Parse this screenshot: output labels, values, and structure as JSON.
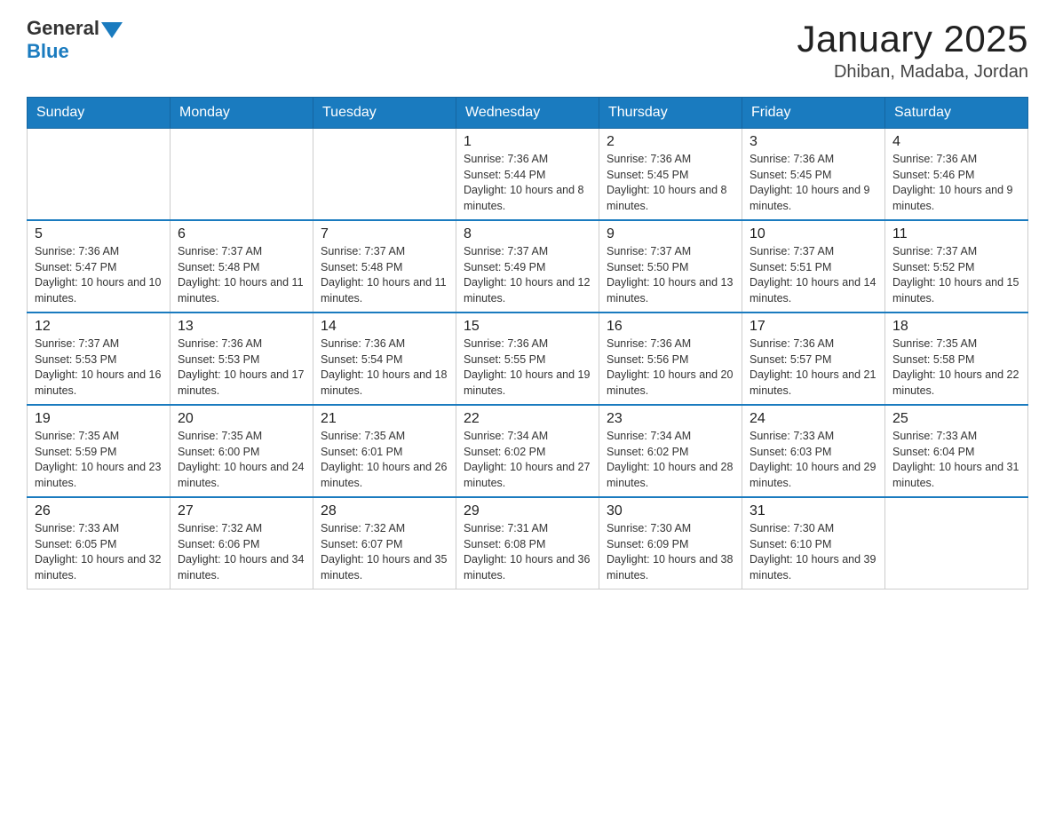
{
  "header": {
    "logo_text_main": "General",
    "logo_text_blue": "Blue",
    "title": "January 2025",
    "subtitle": "Dhiban, Madaba, Jordan"
  },
  "days_of_week": [
    "Sunday",
    "Monday",
    "Tuesday",
    "Wednesday",
    "Thursday",
    "Friday",
    "Saturday"
  ],
  "weeks": [
    [
      {
        "day": "",
        "info": ""
      },
      {
        "day": "",
        "info": ""
      },
      {
        "day": "",
        "info": ""
      },
      {
        "day": "1",
        "info": "Sunrise: 7:36 AM\nSunset: 5:44 PM\nDaylight: 10 hours and 8 minutes."
      },
      {
        "day": "2",
        "info": "Sunrise: 7:36 AM\nSunset: 5:45 PM\nDaylight: 10 hours and 8 minutes."
      },
      {
        "day": "3",
        "info": "Sunrise: 7:36 AM\nSunset: 5:45 PM\nDaylight: 10 hours and 9 minutes."
      },
      {
        "day": "4",
        "info": "Sunrise: 7:36 AM\nSunset: 5:46 PM\nDaylight: 10 hours and 9 minutes."
      }
    ],
    [
      {
        "day": "5",
        "info": "Sunrise: 7:36 AM\nSunset: 5:47 PM\nDaylight: 10 hours and 10 minutes."
      },
      {
        "day": "6",
        "info": "Sunrise: 7:37 AM\nSunset: 5:48 PM\nDaylight: 10 hours and 11 minutes."
      },
      {
        "day": "7",
        "info": "Sunrise: 7:37 AM\nSunset: 5:48 PM\nDaylight: 10 hours and 11 minutes."
      },
      {
        "day": "8",
        "info": "Sunrise: 7:37 AM\nSunset: 5:49 PM\nDaylight: 10 hours and 12 minutes."
      },
      {
        "day": "9",
        "info": "Sunrise: 7:37 AM\nSunset: 5:50 PM\nDaylight: 10 hours and 13 minutes."
      },
      {
        "day": "10",
        "info": "Sunrise: 7:37 AM\nSunset: 5:51 PM\nDaylight: 10 hours and 14 minutes."
      },
      {
        "day": "11",
        "info": "Sunrise: 7:37 AM\nSunset: 5:52 PM\nDaylight: 10 hours and 15 minutes."
      }
    ],
    [
      {
        "day": "12",
        "info": "Sunrise: 7:37 AM\nSunset: 5:53 PM\nDaylight: 10 hours and 16 minutes."
      },
      {
        "day": "13",
        "info": "Sunrise: 7:36 AM\nSunset: 5:53 PM\nDaylight: 10 hours and 17 minutes."
      },
      {
        "day": "14",
        "info": "Sunrise: 7:36 AM\nSunset: 5:54 PM\nDaylight: 10 hours and 18 minutes."
      },
      {
        "day": "15",
        "info": "Sunrise: 7:36 AM\nSunset: 5:55 PM\nDaylight: 10 hours and 19 minutes."
      },
      {
        "day": "16",
        "info": "Sunrise: 7:36 AM\nSunset: 5:56 PM\nDaylight: 10 hours and 20 minutes."
      },
      {
        "day": "17",
        "info": "Sunrise: 7:36 AM\nSunset: 5:57 PM\nDaylight: 10 hours and 21 minutes."
      },
      {
        "day": "18",
        "info": "Sunrise: 7:35 AM\nSunset: 5:58 PM\nDaylight: 10 hours and 22 minutes."
      }
    ],
    [
      {
        "day": "19",
        "info": "Sunrise: 7:35 AM\nSunset: 5:59 PM\nDaylight: 10 hours and 23 minutes."
      },
      {
        "day": "20",
        "info": "Sunrise: 7:35 AM\nSunset: 6:00 PM\nDaylight: 10 hours and 24 minutes."
      },
      {
        "day": "21",
        "info": "Sunrise: 7:35 AM\nSunset: 6:01 PM\nDaylight: 10 hours and 26 minutes."
      },
      {
        "day": "22",
        "info": "Sunrise: 7:34 AM\nSunset: 6:02 PM\nDaylight: 10 hours and 27 minutes."
      },
      {
        "day": "23",
        "info": "Sunrise: 7:34 AM\nSunset: 6:02 PM\nDaylight: 10 hours and 28 minutes."
      },
      {
        "day": "24",
        "info": "Sunrise: 7:33 AM\nSunset: 6:03 PM\nDaylight: 10 hours and 29 minutes."
      },
      {
        "day": "25",
        "info": "Sunrise: 7:33 AM\nSunset: 6:04 PM\nDaylight: 10 hours and 31 minutes."
      }
    ],
    [
      {
        "day": "26",
        "info": "Sunrise: 7:33 AM\nSunset: 6:05 PM\nDaylight: 10 hours and 32 minutes."
      },
      {
        "day": "27",
        "info": "Sunrise: 7:32 AM\nSunset: 6:06 PM\nDaylight: 10 hours and 34 minutes."
      },
      {
        "day": "28",
        "info": "Sunrise: 7:32 AM\nSunset: 6:07 PM\nDaylight: 10 hours and 35 minutes."
      },
      {
        "day": "29",
        "info": "Sunrise: 7:31 AM\nSunset: 6:08 PM\nDaylight: 10 hours and 36 minutes."
      },
      {
        "day": "30",
        "info": "Sunrise: 7:30 AM\nSunset: 6:09 PM\nDaylight: 10 hours and 38 minutes."
      },
      {
        "day": "31",
        "info": "Sunrise: 7:30 AM\nSunset: 6:10 PM\nDaylight: 10 hours and 39 minutes."
      },
      {
        "day": "",
        "info": ""
      }
    ]
  ]
}
